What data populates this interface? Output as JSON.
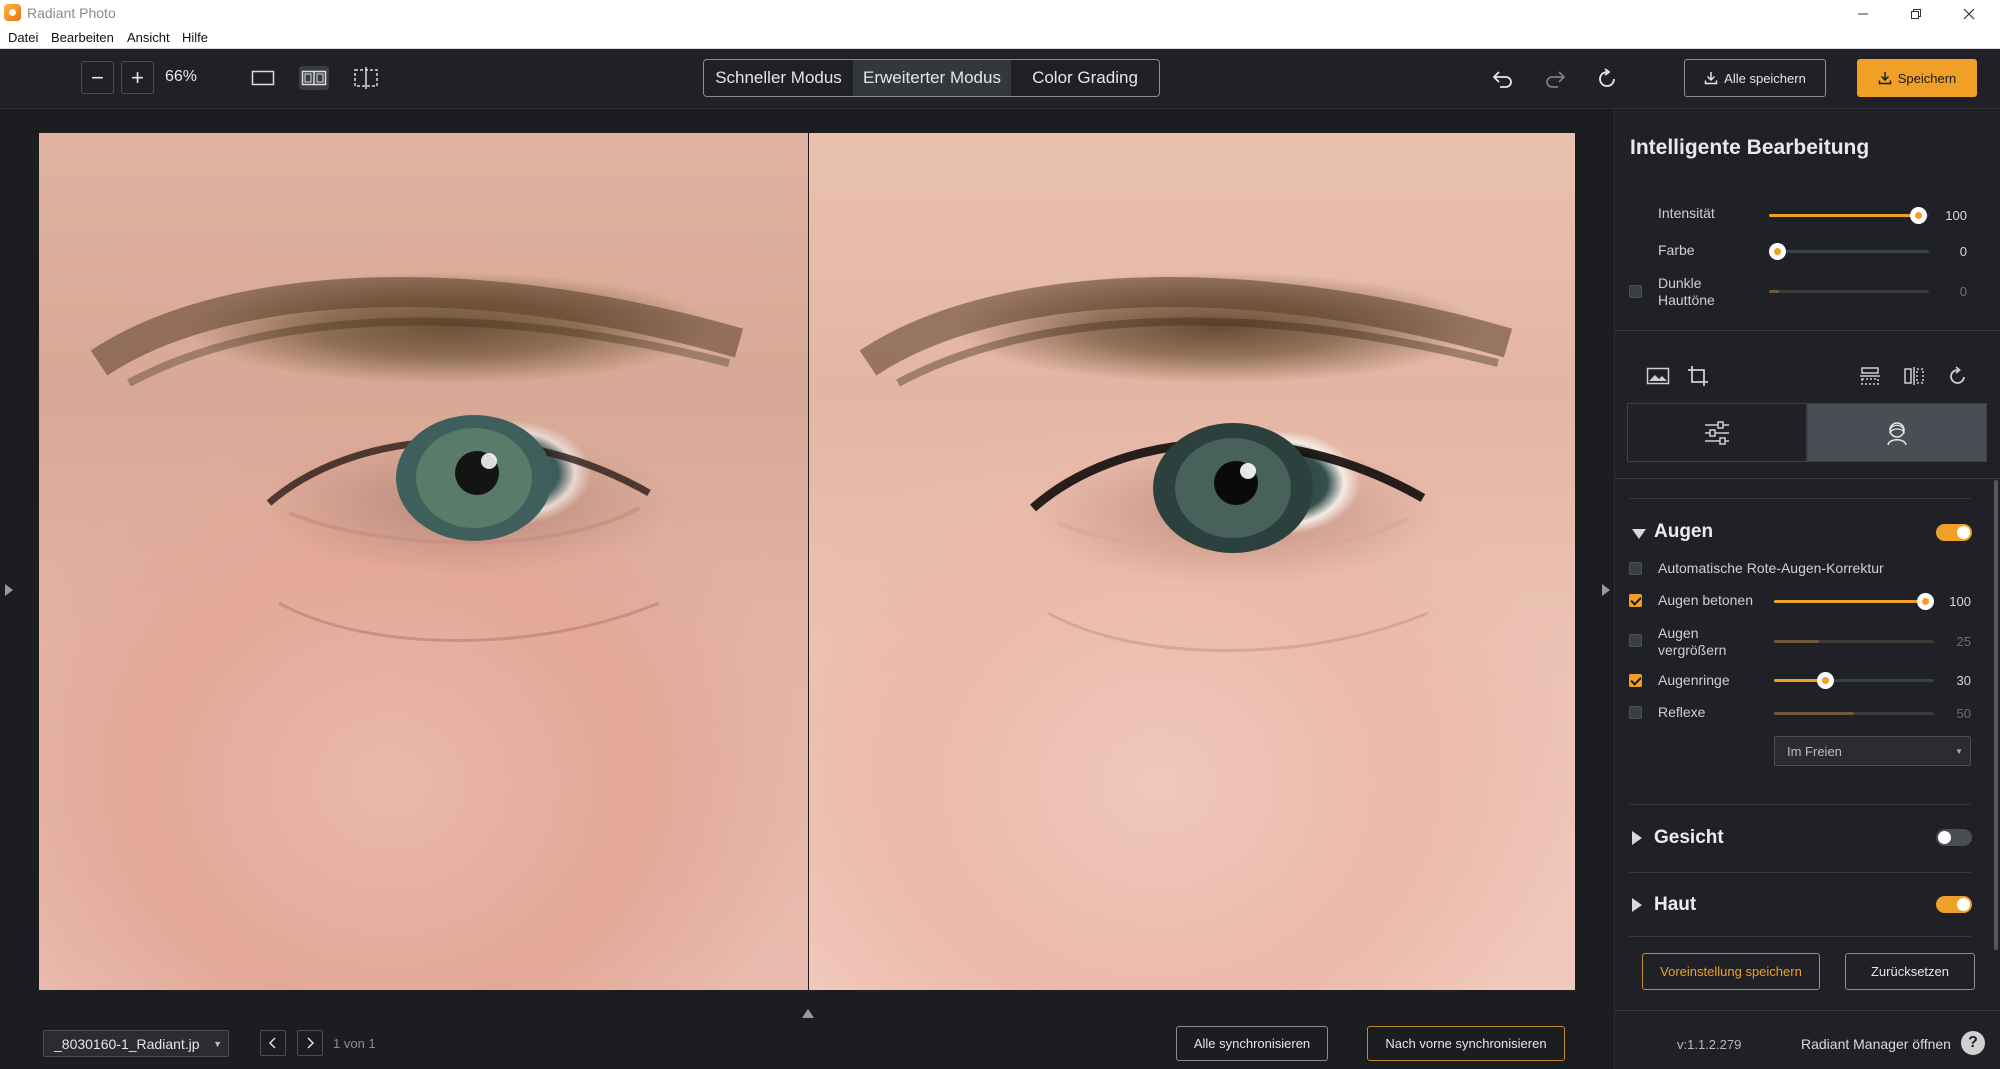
{
  "window": {
    "title": "Radiant Photo",
    "menu": [
      "Datei",
      "Bearbeiten",
      "Ansicht",
      "Hilfe"
    ]
  },
  "toolbar": {
    "zoom_out": "−",
    "zoom_in": "+",
    "zoom_level": "66%",
    "modes": [
      "Schneller Modus",
      "Erweiterter Modus",
      "Color Grading"
    ],
    "active_mode": "Erweiterter Modus",
    "save_all_label": "Alle speichern",
    "save_label": "Speichern"
  },
  "bottom": {
    "file_name": "_8030160-1_Radiant.jp",
    "page_count": "1 von 1",
    "sync_all": "Alle synchronisieren",
    "sync_forward": "Nach vorne synchronisieren"
  },
  "panel": {
    "title": "Intelligente Bearbeitung",
    "smart": {
      "intensity_label": "Intensität",
      "intensity_value": "100",
      "intensity_fraction": 1.0,
      "color_label": "Farbe",
      "color_value": "0",
      "color_fraction": 0.0,
      "dark_skin_label_1": "Dunkle",
      "dark_skin_label_2": "Hauttöne",
      "dark_skin_value": "0",
      "dark_skin_checked": false
    },
    "eyes": {
      "title": "Augen",
      "enabled": true,
      "red_eye_label": "Automatische Rote-Augen-Korrektur",
      "red_eye_checked": false,
      "enhance_label": "Augen betonen",
      "enhance_value": "100",
      "enhance_checked": true,
      "enlarge_label_1": "Augen",
      "enlarge_label_2": "vergrößern",
      "enlarge_value": "25",
      "enlarge_checked": false,
      "rings_label": "Augenringe",
      "rings_value": "30",
      "rings_checked": true,
      "reflex_label": "Reflexe",
      "reflex_value": "50",
      "reflex_checked": false,
      "reflex_mode": "Im Freien"
    },
    "face": {
      "title": "Gesicht",
      "enabled": false
    },
    "skin": {
      "title": "Haut",
      "enabled": true
    },
    "save_preset_label": "Voreinstellung speichern",
    "reset_label": "Zurücksetzen",
    "version": "v:1.1.2.279",
    "manager_label": "Radiant Manager öffnen",
    "help_label": "?"
  },
  "colors": {
    "accent": "#f0a027",
    "background": "#1b1d21",
    "panel": "#1f2126"
  }
}
